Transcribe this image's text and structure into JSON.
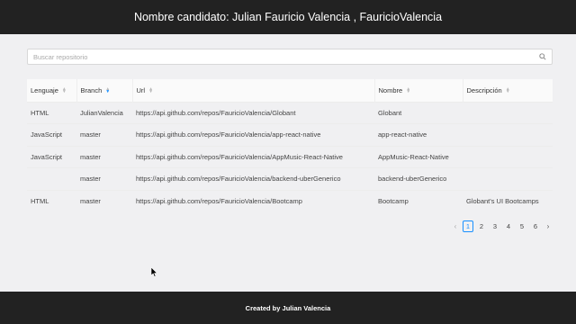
{
  "header": {
    "title": "Nombre candidato: Julian Fauricio Valencia , FauricioValencia"
  },
  "search": {
    "placeholder": "Buscar repositorio",
    "value": ""
  },
  "table": {
    "columns": [
      "Lenguaje",
      "Branch",
      "Url",
      "Nombre",
      "Descripción"
    ],
    "sorted_column": "Branch",
    "rows": [
      {
        "lenguaje": "HTML",
        "branch": "JulianValencia",
        "url": "https://api.github.com/repos/FauricioValencia/Globant",
        "nombre": "Globant",
        "descripcion": ""
      },
      {
        "lenguaje": "JavaScript",
        "branch": "master",
        "url": "https://api.github.com/repos/FauricioValencia/app-react-native",
        "nombre": "app-react-native",
        "descripcion": ""
      },
      {
        "lenguaje": "JavaScript",
        "branch": "master",
        "url": "https://api.github.com/repos/FauricioValencia/AppMusic-React-Native",
        "nombre": "AppMusic-React-Native",
        "descripcion": ""
      },
      {
        "lenguaje": "",
        "branch": "master",
        "url": "https://api.github.com/repos/FauricioValencia/backend-uberGenerico",
        "nombre": "backend-uberGenerico",
        "descripcion": ""
      },
      {
        "lenguaje": "HTML",
        "branch": "master",
        "url": "https://api.github.com/repos/FauricioValencia/Bootcamp",
        "nombre": "Bootcamp",
        "descripcion": "Globant's UI Bootcamps"
      }
    ]
  },
  "pagination": {
    "pages": [
      "1",
      "2",
      "3",
      "4",
      "5",
      "6"
    ],
    "current": "1",
    "prev": "‹",
    "next": "›"
  },
  "footer": {
    "text": "Created by Julian Valencia"
  },
  "colors": {
    "accent": "#1890ff",
    "header_bg": "#222222",
    "page_bg": "#f0f0f2"
  }
}
